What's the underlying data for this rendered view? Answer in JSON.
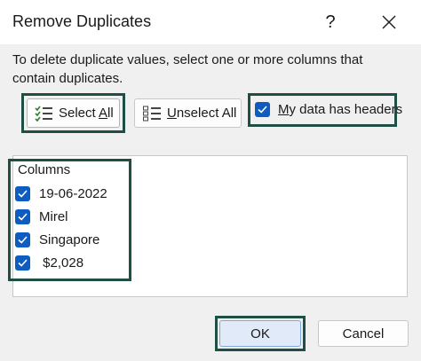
{
  "dialog": {
    "title": "Remove Duplicates",
    "help_label": "?",
    "description": "To delete duplicate values, select one or more columns that contain duplicates."
  },
  "buttons": {
    "select_all_prefix": "Select ",
    "select_all_key": "A",
    "select_all_suffix": "ll",
    "unselect_all_key": "U",
    "unselect_all_suffix": "nselect All",
    "ok": "OK",
    "cancel": "Cancel"
  },
  "headers_checkbox": {
    "label_key": "M",
    "label_rest": "y data has headers",
    "checked": true
  },
  "columns": {
    "header": "Columns",
    "items": [
      {
        "label": "19-06-2022",
        "checked": true
      },
      {
        "label": "Mirel",
        "checked": true
      },
      {
        "label": "Singapore",
        "checked": true
      },
      {
        "label": " $2,028",
        "checked": true
      }
    ]
  },
  "colors": {
    "accent": "#0f5cc0",
    "highlight_border": "#1f4e44",
    "ok_background": "#e0eaf8"
  }
}
